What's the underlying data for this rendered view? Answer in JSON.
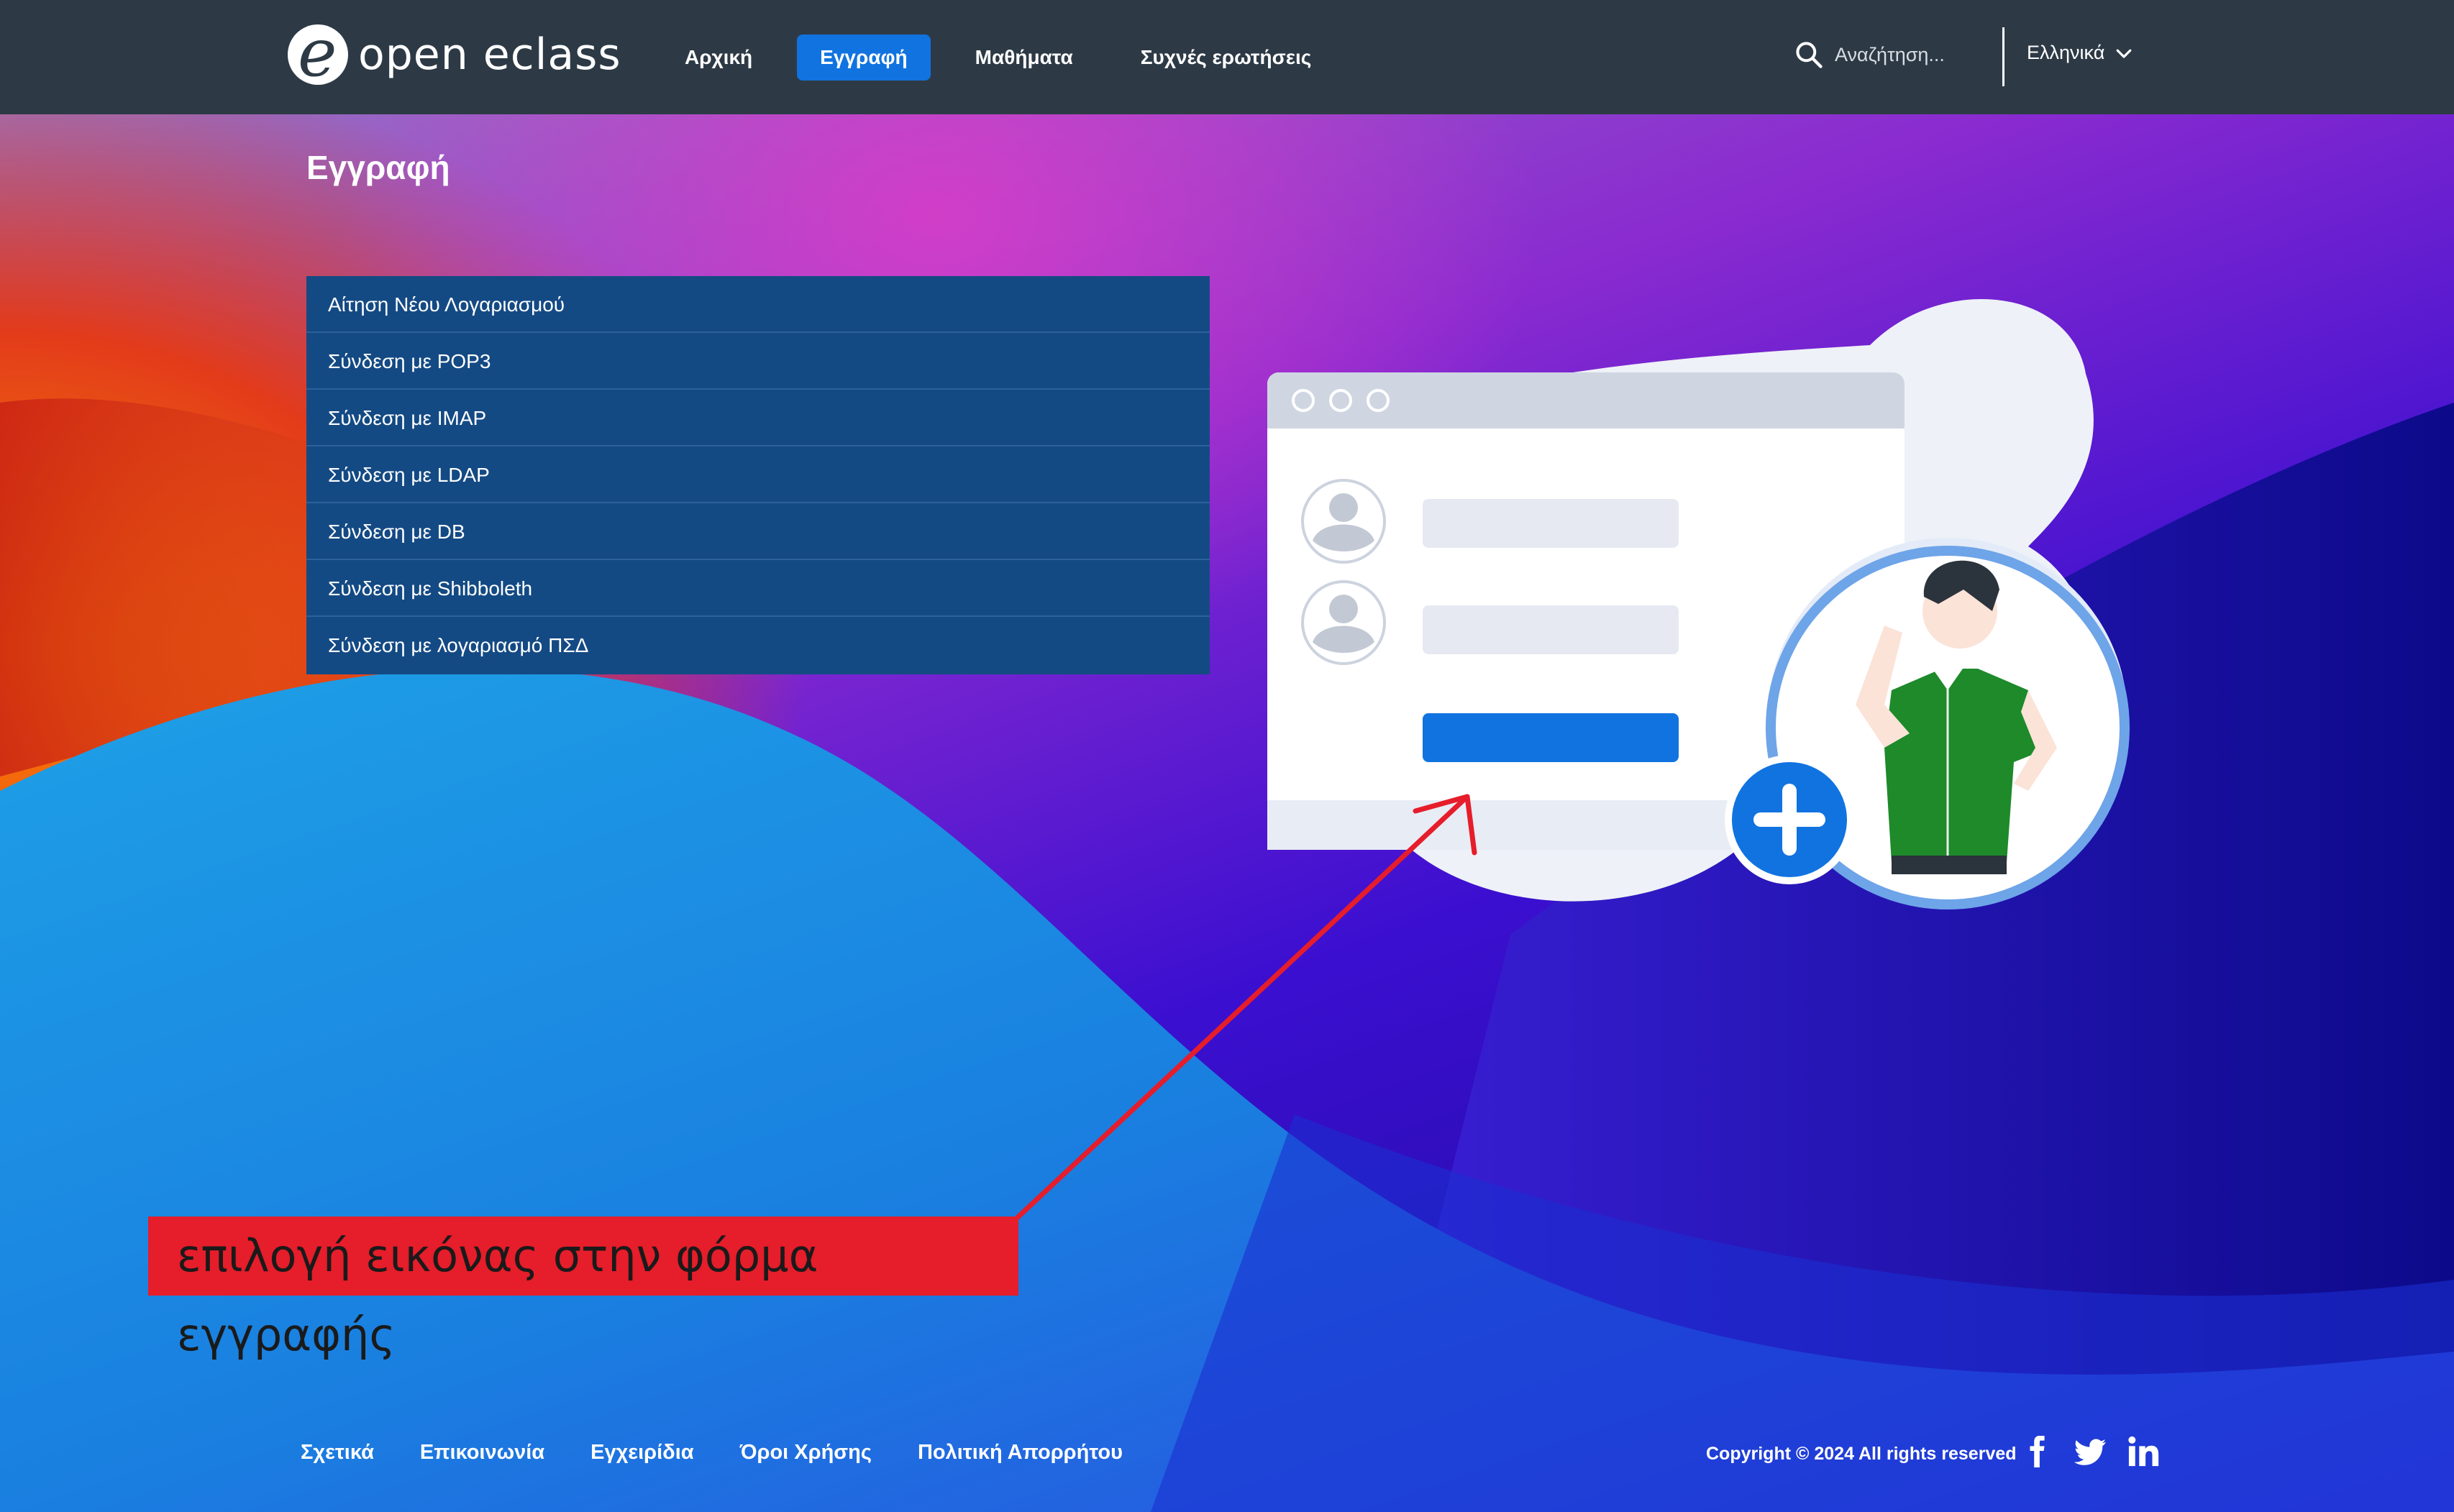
{
  "header": {
    "logo_text": "open eclass",
    "nav": [
      {
        "label": "Αρχική",
        "active": false
      },
      {
        "label": "Εγγραφή",
        "active": true
      },
      {
        "label": "Μαθήματα",
        "active": false
      },
      {
        "label": "Συχνές ερωτήσεις",
        "active": false
      }
    ],
    "search_placeholder": "Αναζήτηση...",
    "language": "Ελληνικά"
  },
  "page_title": "Εγγραφή",
  "menu": [
    "Αίτηση Νέου Λογαριασμού",
    "Σύνδεση με POP3",
    "Σύνδεση με IMAP",
    "Σύνδεση με LDAP",
    "Σύνδεση με DB",
    "Σύνδεση με Shibboleth",
    "Σύνδεση με λογαριασμό ΠΣΔ"
  ],
  "annotation": "επιλογή εικόνας στην φόρμα εγγραφής",
  "footer": {
    "links": [
      "Σχετικά",
      "Επικοινωνία",
      "Εγχειρίδια",
      "Όροι Χρήσης",
      "Πολιτική Απορρήτου"
    ],
    "copyright": "Copyright © 2024 All rights reserved",
    "social_icons": [
      "facebook-icon",
      "twitter-icon",
      "linkedin-icon"
    ]
  },
  "colors": {
    "header_bg": "#2d3a46",
    "accent": "#1173e0",
    "menu_bg": "#144a84",
    "annotation": "#e61d2a",
    "illustration_button": "#1173e0",
    "shirt": "#1e8a2a"
  }
}
